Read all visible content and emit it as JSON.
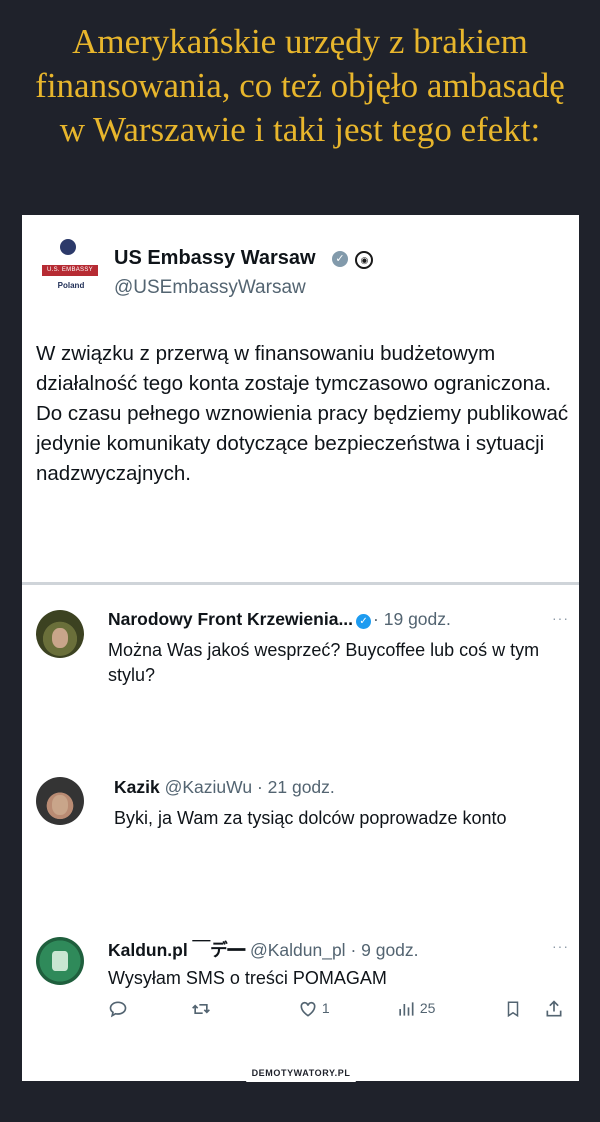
{
  "headline": "Amerykańskie urzędy z brakiem finansowania, co też objęło ambasadę w Warszawie i taki jest tego efekt:",
  "embassy": {
    "seal_label": "U.S. EMBASSY",
    "seal_country": "Poland",
    "name": "US Embassy Warsaw",
    "handle": "@USEmbassyWarsaw",
    "text": "W związku z przerwą w finansowaniu budżetowym działalność tego konta zostaje tymczasowo ograniczona. Do czasu pełnego wznowienia pracy będziemy publikować jedynie komunikaty dotyczące bezpieczeństwa i sytuacji nadzwyczajnych."
  },
  "replies": [
    {
      "name": "Narodowy Front Krzewienia...",
      "handle": "",
      "time": "· 19 godz.",
      "verified": true,
      "text": "Można Was jakoś wesprzeć? Buycoffee lub coś w tym stylu?",
      "more": "···"
    },
    {
      "name": "Kazik",
      "handle": "@KaziuWu",
      "time": "· 21 godz.",
      "verified": false,
      "text": "Byki, ja Wam za tysiąc dolców poprowadze konto"
    },
    {
      "name": "Kaldun.pl ￣デ━",
      "handle": "@Kaldun_pl",
      "time": "· 9 godz.",
      "verified": false,
      "text": "Wysyłam SMS o treści POMAGAM",
      "more": "···"
    }
  ],
  "actions": {
    "reply_icon": "reply-icon",
    "retweet_icon": "retweet-icon",
    "like_icon": "like-icon",
    "like_count": "1",
    "views_icon": "views-icon",
    "views_count": "25",
    "bookmark_icon": "bookmark-icon",
    "share_icon": "share-icon"
  },
  "watermark": "DEMOTYWATORY.PL",
  "colors": {
    "background": "#1f222b",
    "headline": "#e8b62c",
    "verified": "#1d9bf0"
  }
}
